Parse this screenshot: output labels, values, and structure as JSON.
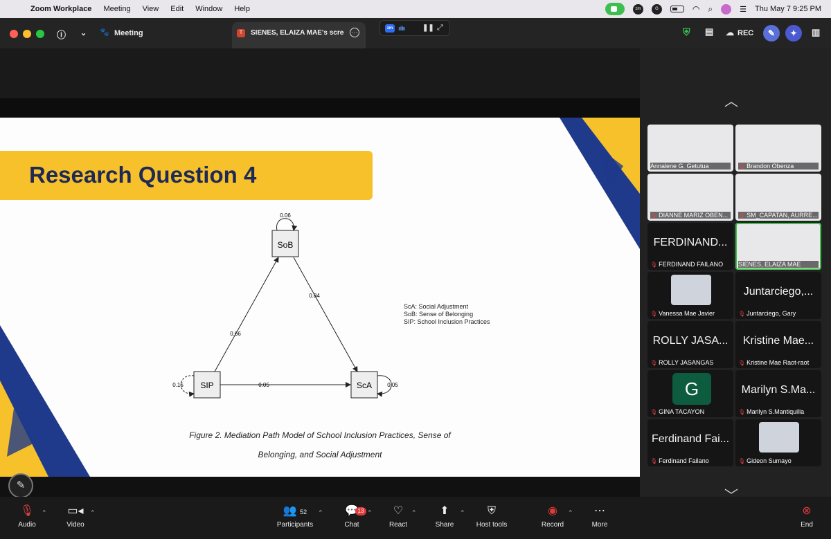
{
  "menubar": {
    "app_name": "Zoom Workplace",
    "items": [
      "Meeting",
      "View",
      "Edit",
      "Window",
      "Help"
    ],
    "datetime": "Thu May 7  9:25 PM"
  },
  "titlebar": {
    "meeting_label": "Meeting",
    "tab_label": "SIENES, ELAIZA MAE's screen",
    "tab_icon_letter": "T",
    "talk_badge": "zm",
    "rec_label": "REC"
  },
  "slide": {
    "title": "Research Question 4",
    "legend": [
      "ScA: Social Adjustment",
      "SoB: Sense of Belonging",
      "SIP: School Inclusion Practices"
    ],
    "caption_line1": "Figure 2. Mediation Path Model of School Inclusion Practices, Sense of",
    "caption_line2": "Belonging, and Social Adjustment",
    "nodes": {
      "sob": "SoB",
      "sip": "SIP",
      "sca": "ScA"
    },
    "values": {
      "sob_self": "0.06",
      "sob_sca": "0.84",
      "sip_sob": "0.66",
      "sip_sca": "0.05",
      "sip_self": "0.15",
      "sca_self": "0.05"
    }
  },
  "participants": [
    {
      "name": "Annalene G. Getutua",
      "muted": false,
      "big": ""
    },
    {
      "name": "Brandon Obenza",
      "muted": true,
      "big": ""
    },
    {
      "name": "DIANNE MARIZ OBEN...",
      "muted": true,
      "big": ""
    },
    {
      "name": "SM_CAPATAN, AURRE...",
      "muted": true,
      "big": ""
    },
    {
      "name": "FERDINAND FAILANO",
      "muted": true,
      "big": "FERDINAND..."
    },
    {
      "name": "SIENES, ELAIZA MAE",
      "muted": false,
      "big": ""
    },
    {
      "name": "Vanessa Mae Javier",
      "muted": true,
      "big": ""
    },
    {
      "name": "Juntarciego, Gary",
      "muted": true,
      "big": "Juntarciego,..."
    },
    {
      "name": "ROLLY JASANGAS",
      "muted": true,
      "big": "ROLLY JASA..."
    },
    {
      "name": "Kristine Mae Raot-raot",
      "muted": true,
      "big": "Kristine Mae..."
    },
    {
      "name": "GINA TACAYON",
      "muted": true,
      "big": ""
    },
    {
      "name": "Marilyn S.Mantiquilla",
      "muted": true,
      "big": "Marilyn S.Ma..."
    },
    {
      "name": "Ferdinand Failano",
      "muted": true,
      "big": "Ferdinand Fai..."
    },
    {
      "name": "Gideon Sumayo",
      "muted": true,
      "big": ""
    }
  ],
  "gina_initial": "G",
  "toolbar": {
    "audio": "Audio",
    "video": "Video",
    "participants": "Participants",
    "participants_count": "52",
    "chat": "Chat",
    "chat_badge": "13",
    "react": "React",
    "share": "Share",
    "host_tools": "Host tools",
    "record": "Record",
    "more": "More",
    "end": "End"
  },
  "colors": {
    "accent_yellow": "#f7c12c",
    "navy": "#1e2a56",
    "record_red": "#e03a3a",
    "active_green": "#3fbf4a"
  }
}
